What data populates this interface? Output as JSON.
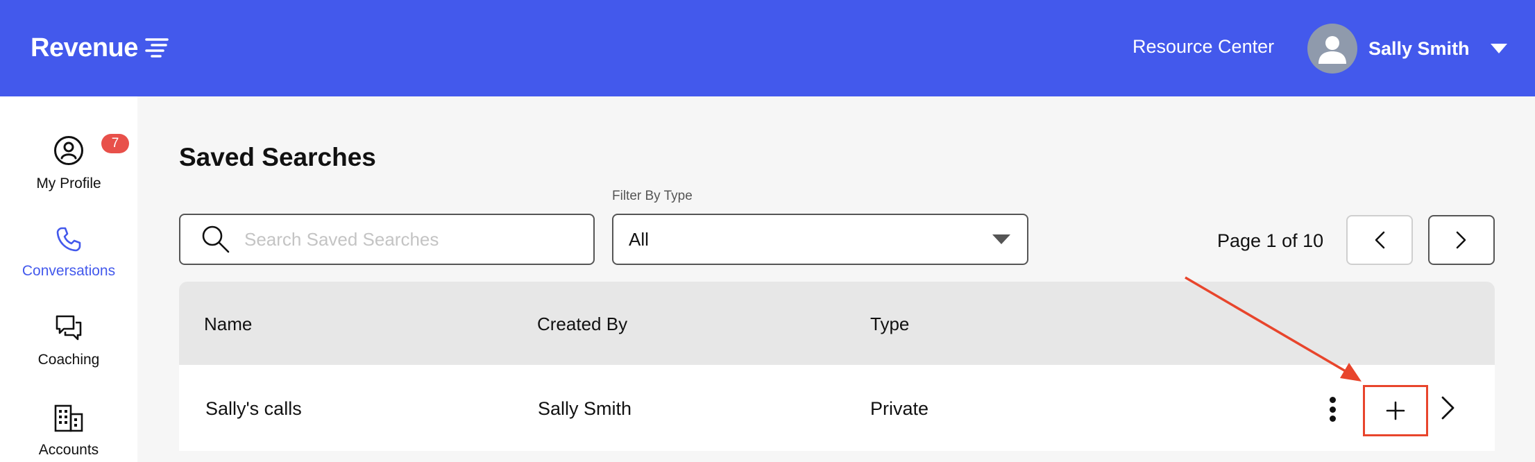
{
  "header": {
    "logo_text": "Revenue",
    "resource_center": "Resource Center",
    "user_name": "Sally Smith"
  },
  "sidebar": {
    "items": [
      {
        "label": "My Profile",
        "icon": "user-circle-icon",
        "badge": "7"
      },
      {
        "label": "Conversations",
        "icon": "phone-icon",
        "active": true
      },
      {
        "label": "Coaching",
        "icon": "chat-bubbles-icon"
      },
      {
        "label": "Accounts",
        "icon": "building-icon"
      }
    ]
  },
  "main": {
    "title": "Saved Searches",
    "search": {
      "placeholder": "Search Saved Searches",
      "value": ""
    },
    "filter": {
      "label": "Filter By Type",
      "value": "All"
    },
    "pagination": {
      "text": "Page 1 of 10"
    },
    "table": {
      "columns": [
        "Name",
        "Created By",
        "Type"
      ],
      "rows": [
        {
          "name": "Sally's calls",
          "created_by": "Sally Smith",
          "type": "Private"
        }
      ]
    }
  },
  "colors": {
    "brand": "#4359ec",
    "badge": "#e8504a",
    "annotation": "#e8452c"
  }
}
